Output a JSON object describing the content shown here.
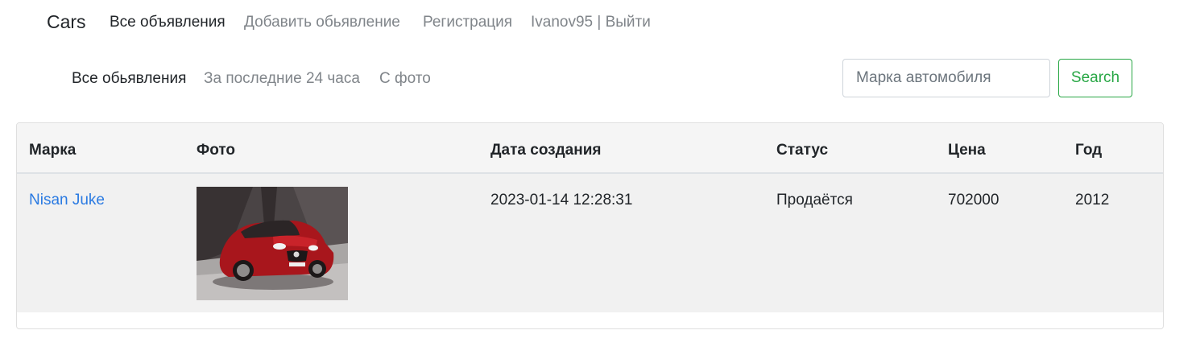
{
  "navbar": {
    "brand": "Cars",
    "links": [
      {
        "label": "Все объявления",
        "active": true
      },
      {
        "label": "Добавить обьявление",
        "active": false
      },
      {
        "label": "Регистрация",
        "active": false
      },
      {
        "label": "Ivanov95 | Выйти",
        "active": false
      }
    ]
  },
  "filters": {
    "links": [
      {
        "label": "Все обьявления",
        "active": true
      },
      {
        "label": "За последние 24 часа",
        "active": false
      },
      {
        "label": "С фото",
        "active": false
      }
    ]
  },
  "search": {
    "placeholder": "Марка автомобиля",
    "value": "",
    "button_label": "Search"
  },
  "table": {
    "headers": [
      "Марка",
      "Фото",
      "Дата создания",
      "Статус",
      "Цена",
      "Год"
    ],
    "rows": [
      {
        "brand": "Nisan Juke",
        "photo_icon": "car-photo",
        "created": "2023-01-14 12:28:31",
        "status": "Продаётся",
        "price": "702000",
        "year": "2012"
      }
    ]
  },
  "colors": {
    "link": "#2a7ae2",
    "success": "#28a745",
    "muted": "#80858a",
    "row_bg": "#f1f1f1",
    "header_bg": "#f5f5f5"
  }
}
